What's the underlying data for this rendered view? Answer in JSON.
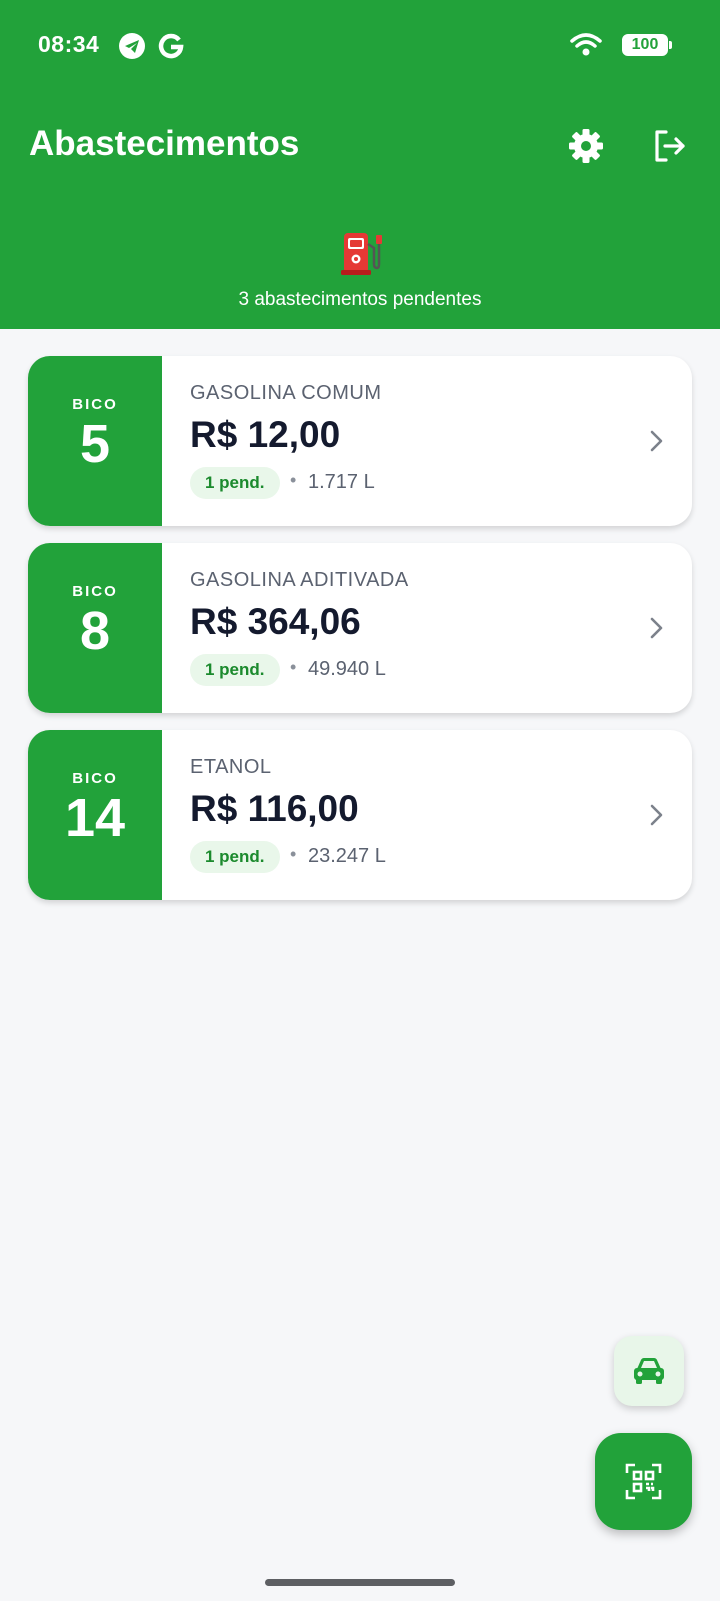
{
  "status_bar": {
    "time": "08:34",
    "battery": "100",
    "icons": [
      "telegram-icon",
      "google-icon",
      "wifi-icon",
      "battery-icon"
    ]
  },
  "header": {
    "title": "Abastecimentos",
    "settings_icon": "gear-icon",
    "logout_icon": "logout-icon",
    "pending_icon": "fuel-pump-icon",
    "pending_text": "3 abastecimentos pendentes"
  },
  "cards": [
    {
      "bico_label": "BICO",
      "bico_number": "5",
      "fuel": "GASOLINA COMUM",
      "price": "R$ 12,00",
      "pending": "1 pend.",
      "separator": "•",
      "liters": "1.717 L"
    },
    {
      "bico_label": "BICO",
      "bico_number": "8",
      "fuel": "GASOLINA ADITIVADA",
      "price": "R$ 364,06",
      "pending": "1 pend.",
      "separator": "•",
      "liters": "49.940 L"
    },
    {
      "bico_label": "BICO",
      "bico_number": "14",
      "fuel": "ETANOL",
      "price": "R$ 116,00",
      "pending": "1 pend.",
      "separator": "•",
      "liters": "23.247 L"
    }
  ],
  "fabs": {
    "car_icon": "car-icon",
    "qr_icon": "qr-scan-icon"
  },
  "colors": {
    "primary": "#22a23a",
    "background": "#f6f7f9",
    "chip_bg": "#e9f7ea",
    "chip_text": "#1b8a2d",
    "price_text": "#141a2e"
  }
}
